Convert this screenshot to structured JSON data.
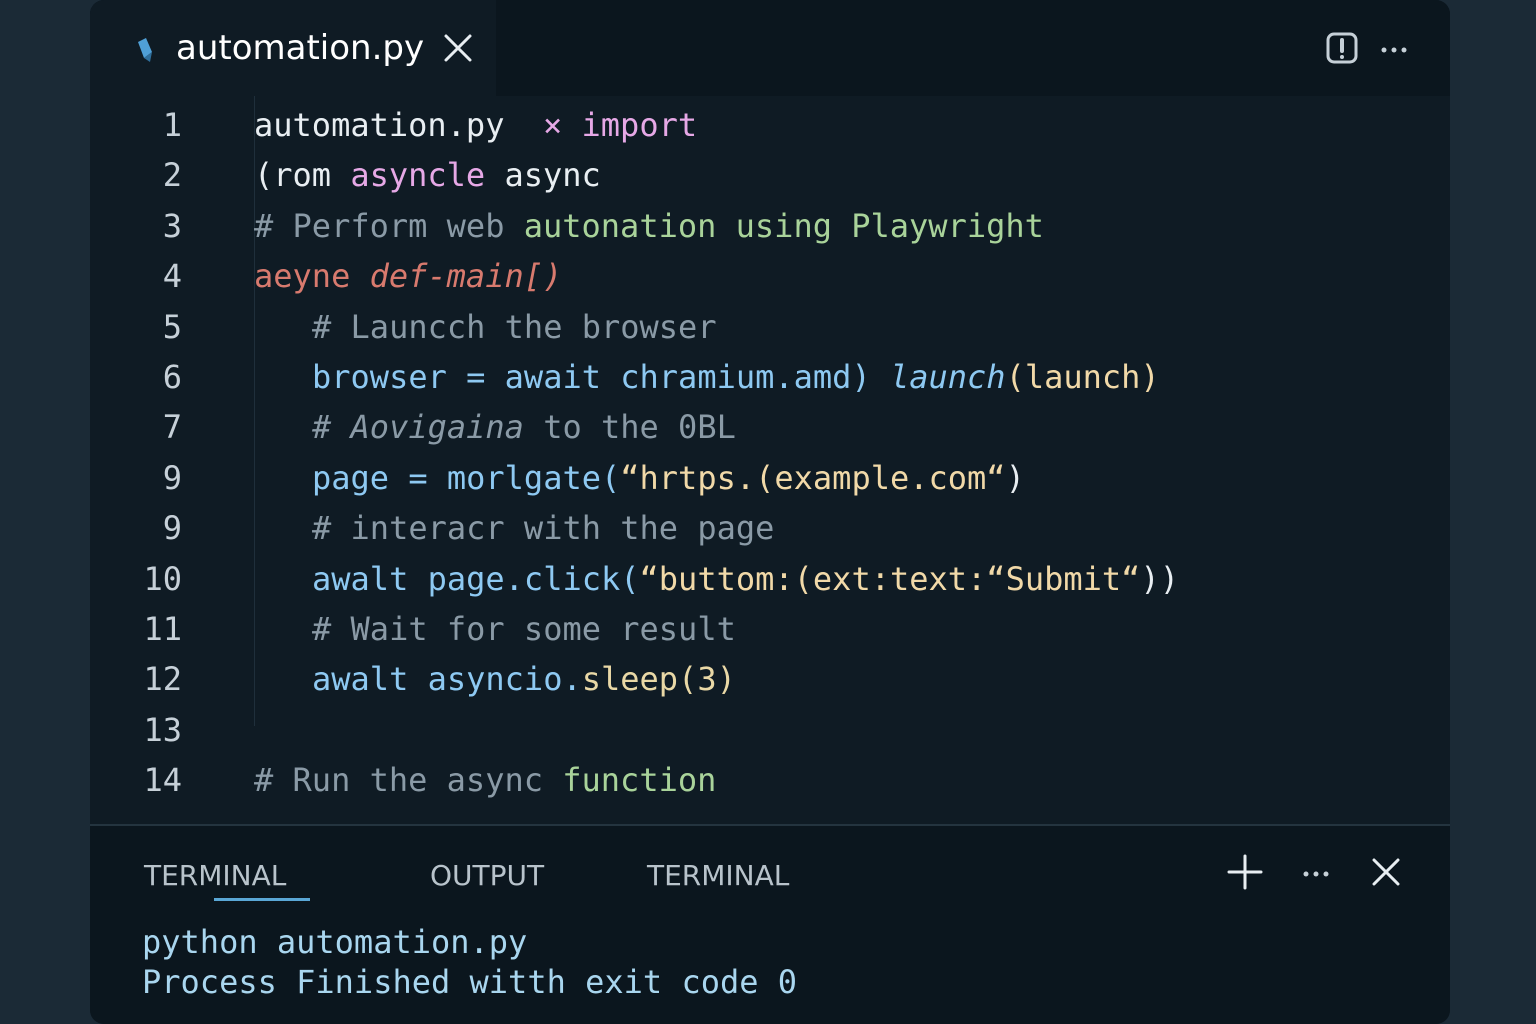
{
  "tab": {
    "title": "automation.py"
  },
  "editor": {
    "lines": [
      {
        "n": "1",
        "parts": [
          {
            "t": "automation.py  ",
            "c": "white"
          },
          {
            "t": "× ",
            "c": "kw"
          },
          {
            "t": "import",
            "c": "kw"
          }
        ]
      },
      {
        "n": "2",
        "parts": [
          {
            "t": "(rom ",
            "c": "white"
          },
          {
            "t": "asyncle",
            "c": "kw"
          },
          {
            "t": " async",
            "c": "white"
          }
        ]
      },
      {
        "n": "3",
        "parts": [
          {
            "t": "# Perform web ",
            "c": "com"
          },
          {
            "t": "autonation using Playwright",
            "c": "green"
          }
        ]
      },
      {
        "n": "4",
        "parts": [
          {
            "t": "aeyne ",
            "c": "red"
          },
          {
            "t": "def-main[)",
            "c": "red it"
          }
        ]
      },
      {
        "n": "5",
        "indent": true,
        "parts": [
          {
            "t": "# Launcch the browser",
            "c": "com"
          }
        ]
      },
      {
        "n": "6",
        "indent": true,
        "parts": [
          {
            "t": "browser = await ",
            "c": "var"
          },
          {
            "t": "chramium.amd) ",
            "c": "fn"
          },
          {
            "t": "launch",
            "c": "fn it"
          },
          {
            "t": "(launch)",
            "c": "str"
          }
        ]
      },
      {
        "n": "7",
        "indent": true,
        "parts": [
          {
            "t": "# Aovigaina ",
            "c": "com it"
          },
          {
            "t": "to the 0BL",
            "c": "com"
          }
        ]
      },
      {
        "n": "9",
        "indent": true,
        "parts": [
          {
            "t": "page = morlgate(",
            "c": "var"
          },
          {
            "t": "“hrtps.(example.com“",
            "c": "str"
          },
          {
            "t": ")",
            "c": "white"
          }
        ]
      },
      {
        "n": "9",
        "indent": true,
        "parts": [
          {
            "t": "# interacr with the page",
            "c": "com"
          }
        ]
      },
      {
        "n": "10",
        "indent": true,
        "parts": [
          {
            "t": "awalt page.click(",
            "c": "var"
          },
          {
            "t": "“buttom:(ext:text:“Submit“",
            "c": "str"
          },
          {
            "t": "))",
            "c": "white"
          }
        ]
      },
      {
        "n": "11",
        "indent": true,
        "parts": [
          {
            "t": "# Wait for some result",
            "c": "com"
          }
        ]
      },
      {
        "n": "12",
        "indent": true,
        "parts": [
          {
            "t": "awalt asyncio.",
            "c": "var"
          },
          {
            "t": "sleep(3)",
            "c": "yel"
          }
        ]
      },
      {
        "n": "13",
        "parts": []
      },
      {
        "n": "14",
        "parts": [
          {
            "t": "# Run the async ",
            "c": "com"
          },
          {
            "t": "function",
            "c": "green"
          }
        ]
      }
    ]
  },
  "panel": {
    "tabs": [
      "TERMINAL",
      "OUTPUT",
      "TERMINAL"
    ],
    "terminal_lines": [
      "python automation.py",
      "Process Finished witth exit code 0"
    ]
  },
  "icons": {
    "file": "pencil-icon",
    "close": "close-icon",
    "split": "split-editor-icon",
    "more": "more-icon",
    "add": "plus-icon"
  }
}
